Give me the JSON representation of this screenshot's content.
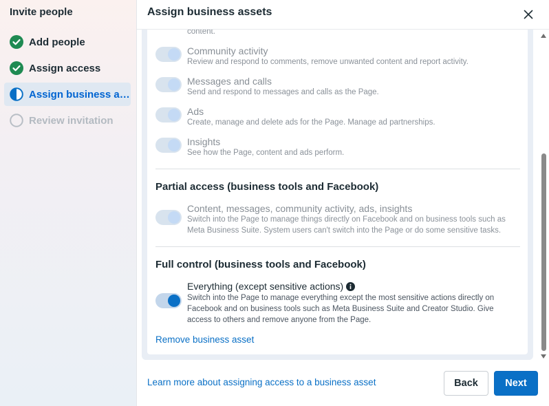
{
  "sidebar": {
    "title": "Invite people",
    "steps": [
      {
        "label": "Add people",
        "state": "done"
      },
      {
        "label": "Assign access",
        "state": "done"
      },
      {
        "label": "Assign business assets",
        "state": "current"
      },
      {
        "label": "Review invitation",
        "state": "pending"
      }
    ]
  },
  "header": {
    "title": "Assign business assets"
  },
  "content": {
    "truncated_top_text": "content.",
    "task_access": [
      {
        "title": "Community activity",
        "description": "Review and respond to comments, remove unwanted content and report activity.",
        "enabled": true
      },
      {
        "title": "Messages and calls",
        "description": "Send and respond to messages and calls as the Page.",
        "enabled": true
      },
      {
        "title": "Ads",
        "description": "Create, manage and delete ads for the Page. Manage ad partnerships.",
        "enabled": true
      },
      {
        "title": "Insights",
        "description": "See how the Page, content and ads perform.",
        "enabled": true
      }
    ],
    "partial": {
      "heading": "Partial access (business tools and Facebook)",
      "title": "Content, messages, community activity, ads, insights",
      "description": "Switch into the Page to manage things directly on Facebook and on business tools such as Meta Business Suite. System users can't switch into the Page or do some sensitive tasks.",
      "enabled": true
    },
    "full": {
      "heading": "Full control (business tools and Facebook)",
      "title": "Everything (except sensitive actions)",
      "description": "Switch into the Page to manage everything except the most sensitive actions directly on Facebook and on business tools such as Meta Business Suite and Creator Studio. Give access to others and remove anyone from the Page.",
      "enabled": true
    },
    "remove_link": "Remove business asset"
  },
  "footer": {
    "learn_link": "Learn more about assigning access to a business asset",
    "back_label": "Back",
    "next_label": "Next"
  },
  "colors": {
    "accent": "#0a70c6",
    "done_green": "#1f8a52",
    "text": "#1c2b33"
  }
}
